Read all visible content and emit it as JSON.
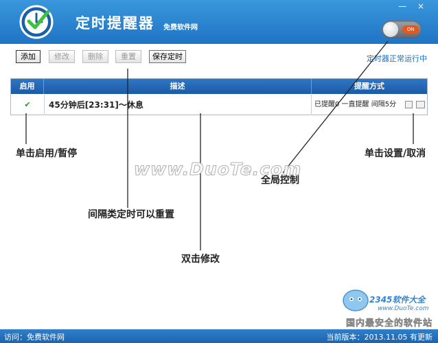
{
  "header": {
    "title": "定时提醒器",
    "subtitle": "免费软件网",
    "window_buttons": {
      "minimize": "—",
      "close": "×"
    },
    "toggle_label": "ON"
  },
  "toolbar": {
    "add": "添加",
    "edit": "修改",
    "delete": "删除",
    "reset": "重置",
    "save": "保存定时",
    "status": "定时器正常运行中"
  },
  "table": {
    "columns": [
      "启用",
      "描述",
      "提醒方式"
    ],
    "rows": [
      {
        "enabled": "✔",
        "description": "45分钟后[23:31]～休息",
        "method": "已提醒0  一直提醒  间隔5分"
      }
    ]
  },
  "annotations": {
    "toggle_enable": "单击启用/暂停",
    "settings_cancel": "单击设置/取消",
    "global_control": "全局控制",
    "interval_reset": "间隔类定时可以重置",
    "double_click_edit": "双击修改"
  },
  "watermark": "www.DuoTe.com",
  "brand": {
    "name": "2345软件大全",
    "url": "www.DuoTe.com",
    "slogan": "国内最安全的软件站"
  },
  "footer": {
    "visit": "访问：免费软件网",
    "version": "当前版本：2013.11.05   有更新"
  },
  "colors": {
    "header_blue": "#1f74c4",
    "status_blue": "#1d6fbd",
    "check_green": "#1a9a2a",
    "toggle_orange": "#e8571a"
  }
}
